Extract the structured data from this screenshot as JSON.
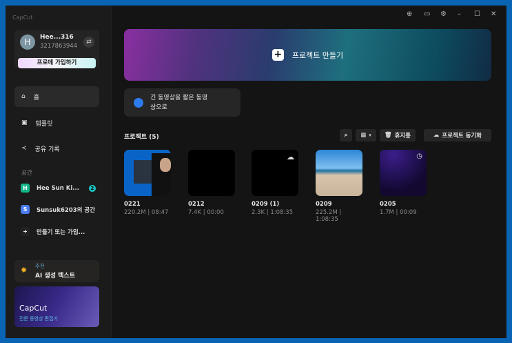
{
  "app": {
    "logo": "CapCut"
  },
  "account": {
    "avatar": "H",
    "name": "Hee...316",
    "id": "3217863944",
    "pro_button": "프로에 가입하기"
  },
  "nav": [
    {
      "label": "홈",
      "icon": "home-icon"
    },
    {
      "label": "템플릿",
      "icon": "template-icon"
    },
    {
      "label": "공유 기록",
      "icon": "share-icon"
    }
  ],
  "spaces": {
    "title": "공간",
    "items": [
      {
        "badge": "H",
        "label": "Hee Sun Ki...",
        "count": "2",
        "color": "#14b88a"
      },
      {
        "badge": "S",
        "label": "Sunsuk6203의 공간",
        "color": "#4a7cf0"
      },
      {
        "badge": "+",
        "label": "만들기 또는 가입..."
      }
    ]
  },
  "recommend": {
    "tag": "추천",
    "title": "AI 생성 텍스트"
  },
  "promo": {
    "title": "CapCut",
    "subtitle": "전문 동영상 편집기"
  },
  "main": {
    "create_label": "프로젝트 만들기",
    "short_label": "긴 동영상을 짧은 동영상으로",
    "projects_title": "프로젝트  (5)",
    "trash": "휴지통",
    "sync": "프로젝트 동기화"
  },
  "projects": [
    {
      "name": "0221",
      "meta": "220.2M | 08:47"
    },
    {
      "name": "0212",
      "meta": "7.4K | 00:00"
    },
    {
      "name": "0209 (1)",
      "meta": "2.3K | 1:08:35"
    },
    {
      "name": "0209",
      "meta": "225.2M | 1:08:35"
    },
    {
      "name": "0205",
      "meta": "1.7M | 00:09"
    }
  ]
}
